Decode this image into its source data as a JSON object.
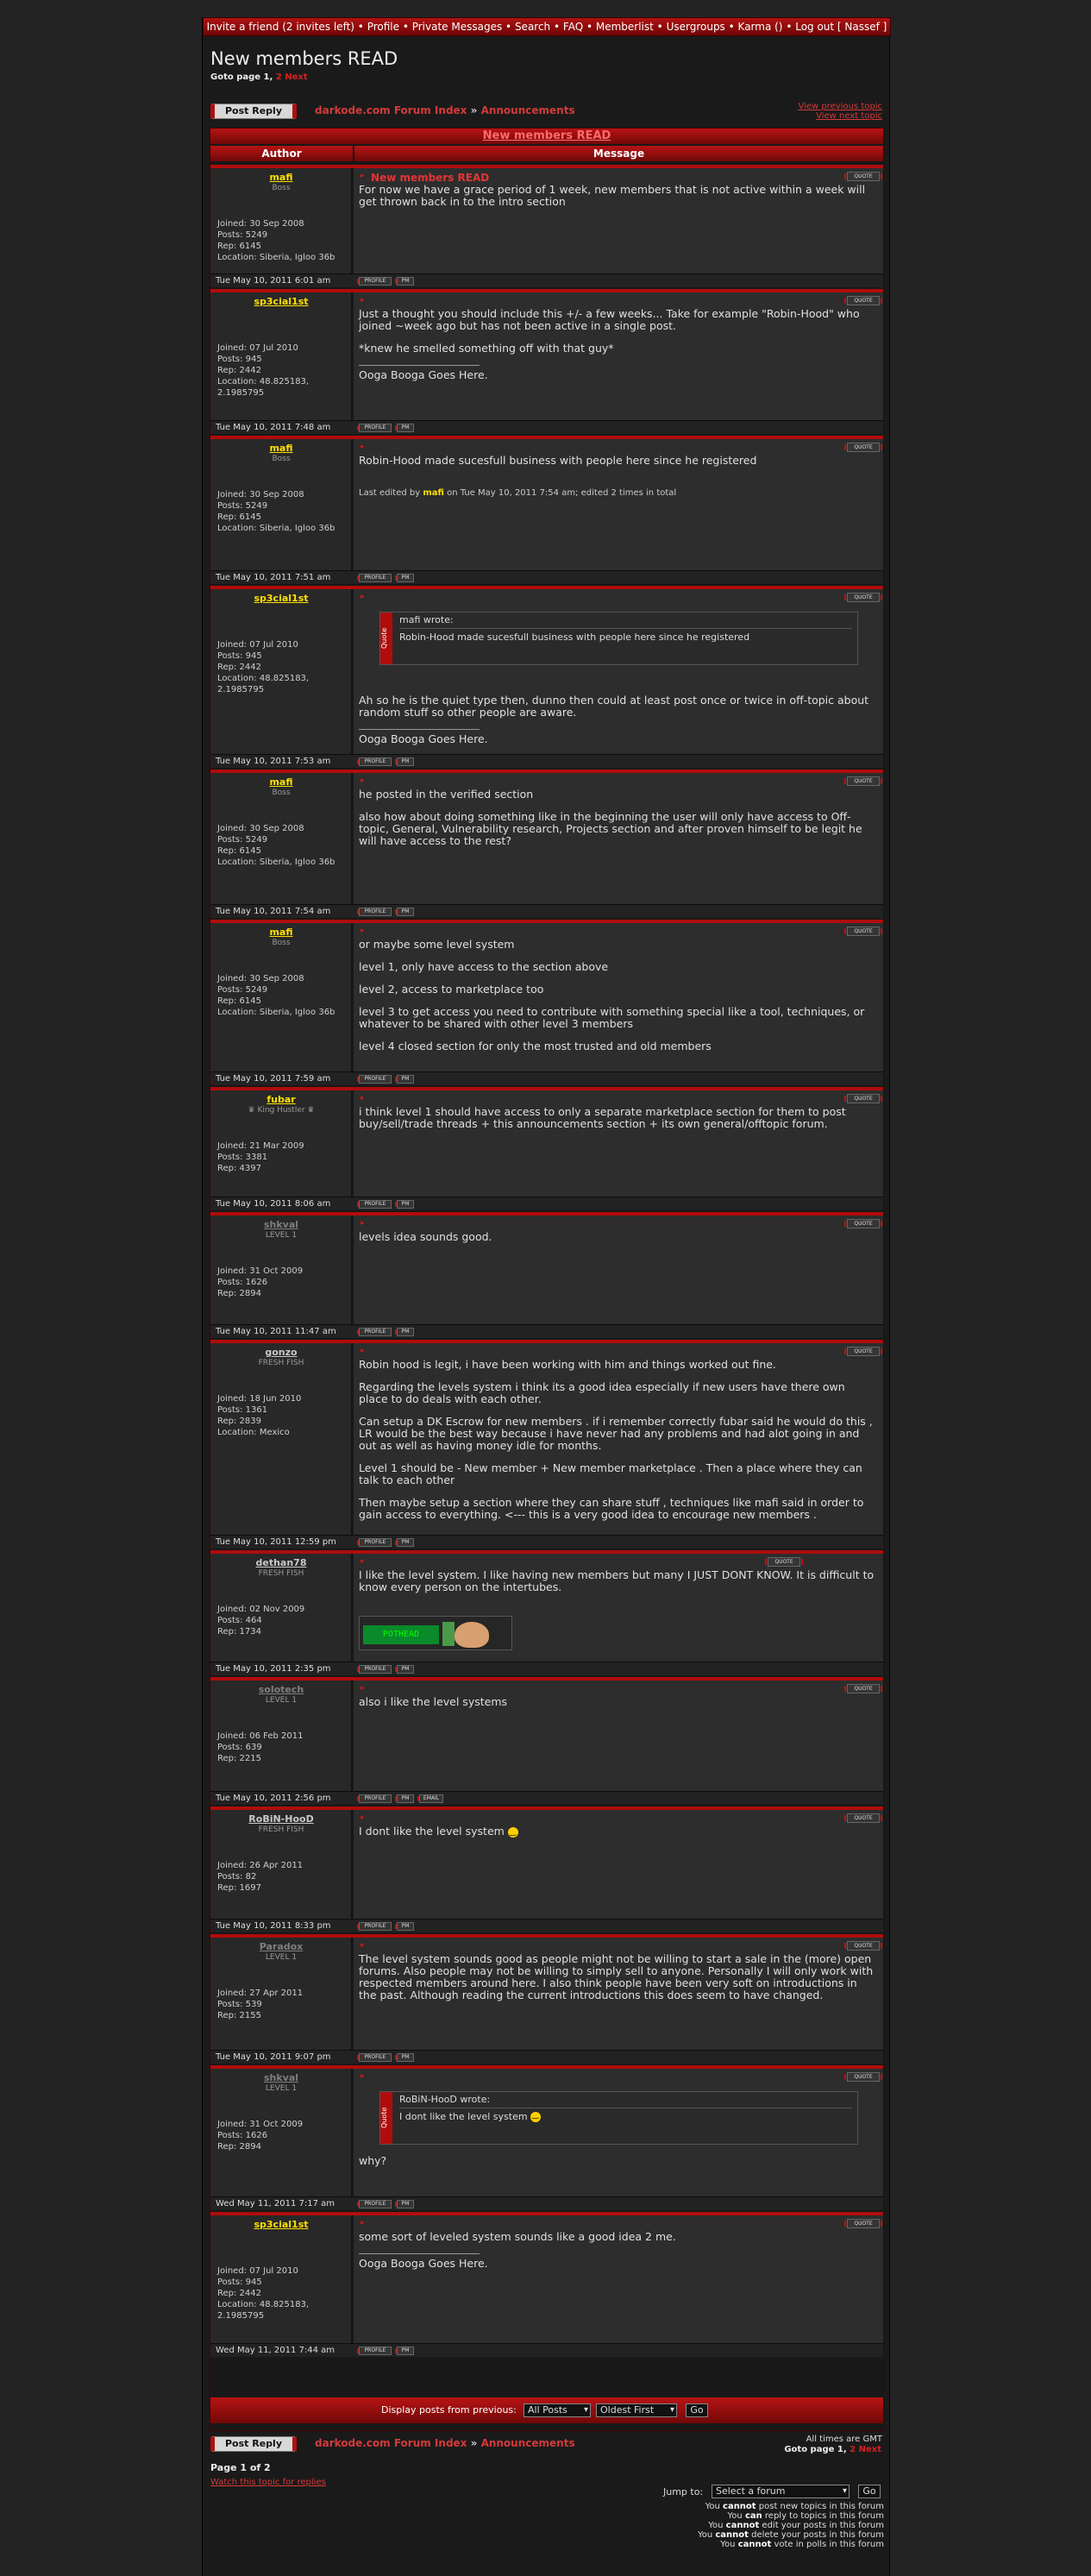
{
  "nav": {
    "items": [
      "Invite a friend (2 invites left)",
      "Profile",
      "Private Messages",
      "Search",
      "FAQ",
      "Memberlist",
      "Usergroups",
      "Karma ()",
      "Log out [ Nassef ]"
    ],
    "sep": "•"
  },
  "page": {
    "title": "New members READ",
    "goto_prefix": "Goto page",
    "goto_current": "1",
    "goto_comma": ",",
    "goto_link2": "2",
    "goto_next": "Next",
    "post_reply": "Post Reply",
    "breadcrumb_index": "darkode.com Forum Index",
    "breadcrumb_sep": "»",
    "breadcrumb_forum": "Announcements",
    "view_prev": "View previous topic",
    "view_next": "View next topic",
    "topic_title": "New members READ",
    "col_author": "Author",
    "col_message": "Message"
  },
  "labels": {
    "quote": "QUOTE",
    "profile": "PROFILE",
    "pm": "PM",
    "email": "EMAIL",
    "quote_tab": "Quote",
    "wrote": "wrote:"
  },
  "posts": [
    {
      "author": "mafi",
      "rank": "Boss",
      "color": "#ffe000",
      "info": [
        "Joined: 30 Sep 2008",
        "Posts: 5249",
        "Rep: 6145",
        "Location: Siberia, Igloo 36b"
      ],
      "subject": "New members READ",
      "body": [
        "For now we have a grace period of 1 week, new members that is not active within a week will get thrown back in to the intro section"
      ],
      "time": "Tue May 10, 2011 6:01 am"
    },
    {
      "author": "sp3cial1st",
      "rank": "",
      "color": "#ffe000",
      "info": [
        "Joined: 07 Jul 2010",
        "Posts: 945",
        "Rep: 2442",
        "Location: 48.825183, 2.1985795"
      ],
      "body": [
        "Just a thought you should include this +/- a few weeks... Take for example \"Robin-Hood\" who joined ~week ago but has not been active in a single post.",
        "*knew he smelled something off with that guy*"
      ],
      "sig": "Ooga Booga Goes Here.",
      "time": "Tue May 10, 2011 7:48 am"
    },
    {
      "author": "mafi",
      "rank": "Boss",
      "color": "#ffe000",
      "info": [
        "Joined: 30 Sep 2008",
        "Posts: 5249",
        "Rep: 6145",
        "Location: Siberia, Igloo 36b"
      ],
      "body": [
        "Robin-Hood made sucesfull business with people here since he registered"
      ],
      "edited_pre": "Last edited by",
      "edited_name": "mafi",
      "edited_post": "on Tue May 10, 2011 7:54 am; edited 2 times in total",
      "time": "Tue May 10, 2011 7:51 am"
    },
    {
      "author": "sp3cial1st",
      "rank": "",
      "color": "#ffe000",
      "info": [
        "Joined: 07 Jul 2010",
        "Posts: 945",
        "Rep: 2442",
        "Location: 48.825183, 2.1985795"
      ],
      "quote_author": "mafi",
      "quote_text": "Robin-Hood made sucesfull business with people here since he registered",
      "body": [
        "Ah so he is the quiet type then, dunno then could at least post once or twice in off-topic about random stuff so other people are aware."
      ],
      "sig": "Ooga Booga Goes Here.",
      "time": "Tue May 10, 2011 7:53 am"
    },
    {
      "author": "mafi",
      "rank": "Boss",
      "color": "#ffe000",
      "info": [
        "Joined: 30 Sep 2008",
        "Posts: 5249",
        "Rep: 6145",
        "Location: Siberia, Igloo 36b"
      ],
      "body": [
        "he posted in the verified section",
        "also how about doing something like in the beginning the user will only have access to Off-topic, General, Vulnerability research, Projects section and after proven himself to be legit he will have access to the rest?"
      ],
      "time": "Tue May 10, 2011 7:54 am"
    },
    {
      "author": "mafi",
      "rank": "Boss",
      "color": "#ffe000",
      "info": [
        "Joined: 30 Sep 2008",
        "Posts: 5249",
        "Rep: 6145",
        "Location: Siberia, Igloo 36b"
      ],
      "body": [
        "or maybe some level system",
        "level 1, only have access to the section above",
        "level 2, access to marketplace too",
        "level 3 to get access you need to contribute with something special like a tool, techniques, or whatever to be shared with other level 3 members",
        "level 4 closed section for only the most trusted and old members"
      ],
      "time": "Tue May 10, 2011 7:59 am"
    },
    {
      "author": "fubar",
      "rank": "♛ King Hustler ♛",
      "color": "#ffe000",
      "info": [
        "Joined: 21 Mar 2009",
        "Posts: 3381",
        "Rep: 4397"
      ],
      "body": [
        "i think level 1 should have access to only a separate marketplace section for them to post buy/sell/trade threads + this announcements section + its own general/offtopic forum."
      ],
      "time": "Tue May 10, 2011 8:06 am"
    },
    {
      "author": "shkval",
      "rank": "LEVEL 1",
      "color": "#7f7f7f",
      "info": [
        "Joined: 31 Oct 2009",
        "Posts: 1626",
        "Rep: 2894"
      ],
      "body": [
        "levels idea sounds good."
      ],
      "time": "Tue May 10, 2011 11:47 am"
    },
    {
      "author": "gonzo",
      "rank": "FRESH FISH",
      "color": "#c9c9c9",
      "info": [
        "Joined: 18 Jun 2010",
        "Posts: 1361",
        "Rep: 2839",
        "Location: Mexico"
      ],
      "body": [
        "Robin hood is legit, i have been working with him and things worked out fine.",
        "Regarding the levels system i think its a good idea especially if new users have there own place to do deals with each other.",
        "Can setup a DK Escrow for new members . if i remember correctly fubar said he would do this , LR would be the best way because i have never had any problems and had alot going in and out as well as having money idle for months.",
        "Level 1 should be - New member + New member marketplace . Then a place where they can talk to each other",
        "Then maybe setup a section where they can share stuff , techniques like mafi said in order to gain access to everything. <--- this is a very good idea to encourage new members ."
      ],
      "time": "Tue May 10, 2011 12:59 pm"
    },
    {
      "author": "dethan78",
      "rank": "FRESH FISH",
      "color": "#c9c9c9",
      "info": [
        "Joined: 02 Nov 2009",
        "Posts: 464",
        "Rep: 1734"
      ],
      "body": [
        "I like the level system. I like having new members but many I JUST DONT KNOW. It is difficult to know every person on the intertubes."
      ],
      "banner_text": "POTHEAD",
      "time": "Tue May 10, 2011 2:35 pm"
    },
    {
      "author": "solotech",
      "rank": "LEVEL 1",
      "color": "#7f7f7f",
      "info": [
        "Joined: 06 Feb 2011",
        "Posts: 639",
        "Rep: 2215"
      ],
      "body": [
        "also i like the level systems"
      ],
      "time": "Tue May 10, 2011 2:56 pm"
    },
    {
      "author": "RoBiN-HooD",
      "rank": "FRESH FISH",
      "color": "#c9c9c9",
      "info": [
        "Joined: 26 Apr 2011",
        "Posts: 82",
        "Rep: 1697"
      ],
      "body": [
        "I dont like the level system"
      ],
      "time": "Tue May 10, 2011 8:33 pm"
    },
    {
      "author": "Paradox",
      "rank": "LEVEL 1",
      "color": "#7f7f7f",
      "info": [
        "Joined: 27 Apr 2011",
        "Posts: 539",
        "Rep: 2155"
      ],
      "body": [
        "The level system sounds good as people might not be willing to start a sale in the (more) open forums. Also people may not be willing to simply sell to anyone. Personally I will only work with respected members around here. I also think people have been very soft on introductions in the past. Although reading the current introductions this does seem to have changed."
      ],
      "time": "Tue May 10, 2011 9:07 pm"
    },
    {
      "author": "shkval",
      "rank": "LEVEL 1",
      "color": "#7f7f7f",
      "info": [
        "Joined: 31 Oct 2009",
        "Posts: 1626",
        "Rep: 2894"
      ],
      "quote_author": "RoBiN-HooD",
      "quote_text": "I dont like the level system",
      "body": [
        "why?"
      ],
      "time": "Wed May 11, 2011 7:17 am"
    },
    {
      "author": "sp3cial1st",
      "rank": "",
      "color": "#ffe000",
      "info": [
        "Joined: 07 Jul 2010",
        "Posts: 945",
        "Rep: 2442",
        "Location: 48.825183, 2.1985795"
      ],
      "body": [
        "some sort of leveled system sounds like a good idea 2 me."
      ],
      "sig": "Ooga Booga Goes Here.",
      "time": "Wed May 11, 2011 7:44 am"
    }
  ],
  "bottom": {
    "display_label": "Display posts from previous:",
    "all_posts": "All Posts",
    "oldest_first": "Oldest First",
    "go": "Go",
    "timezone": "All times are GMT",
    "page_of": "Page 1 of 2",
    "watch": "Watch this topic for replies",
    "jump_to": "Jump to:",
    "select_forum": "Select a forum",
    "perms": [
      [
        "You",
        "cannot",
        "post new topics in this forum"
      ],
      [
        "You",
        "can",
        "reply to topics in this forum"
      ],
      [
        "You",
        "cannot",
        "edit your posts in this forum"
      ],
      [
        "You",
        "cannot",
        "delete your posts in this forum"
      ],
      [
        "You",
        "cannot",
        "vote in polls in this forum"
      ]
    ]
  }
}
